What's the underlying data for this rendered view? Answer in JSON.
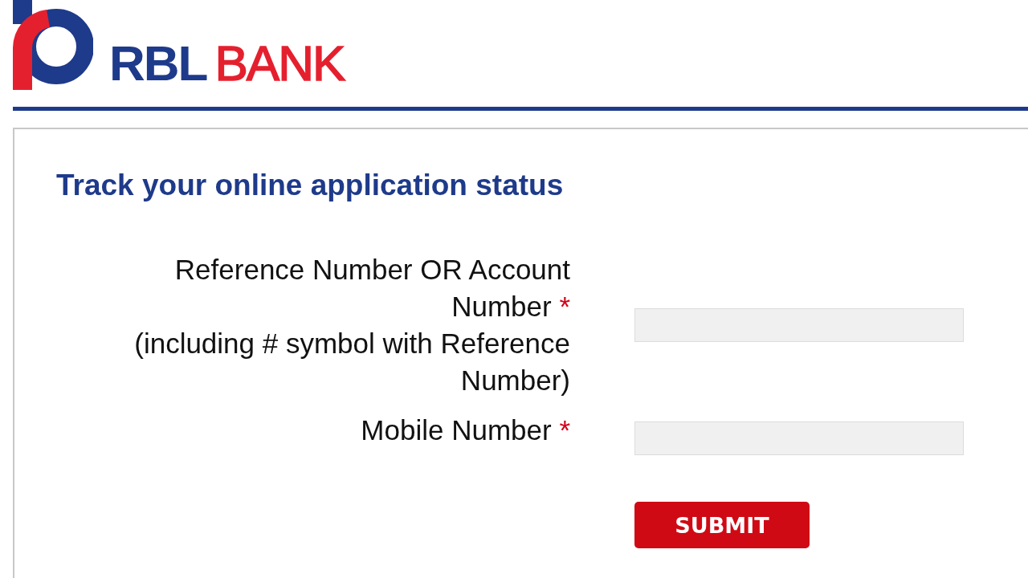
{
  "header": {
    "logo_primary": "RBL",
    "logo_secondary": "BANK"
  },
  "form": {
    "title": "Track your online application status",
    "fields": [
      {
        "label": "Reference Number OR Account Number",
        "required_mark": "*",
        "note": "(including # symbol with Reference Number)"
      },
      {
        "label": "Mobile Number",
        "required_mark": "*"
      }
    ],
    "submit": "SUBMIT"
  }
}
